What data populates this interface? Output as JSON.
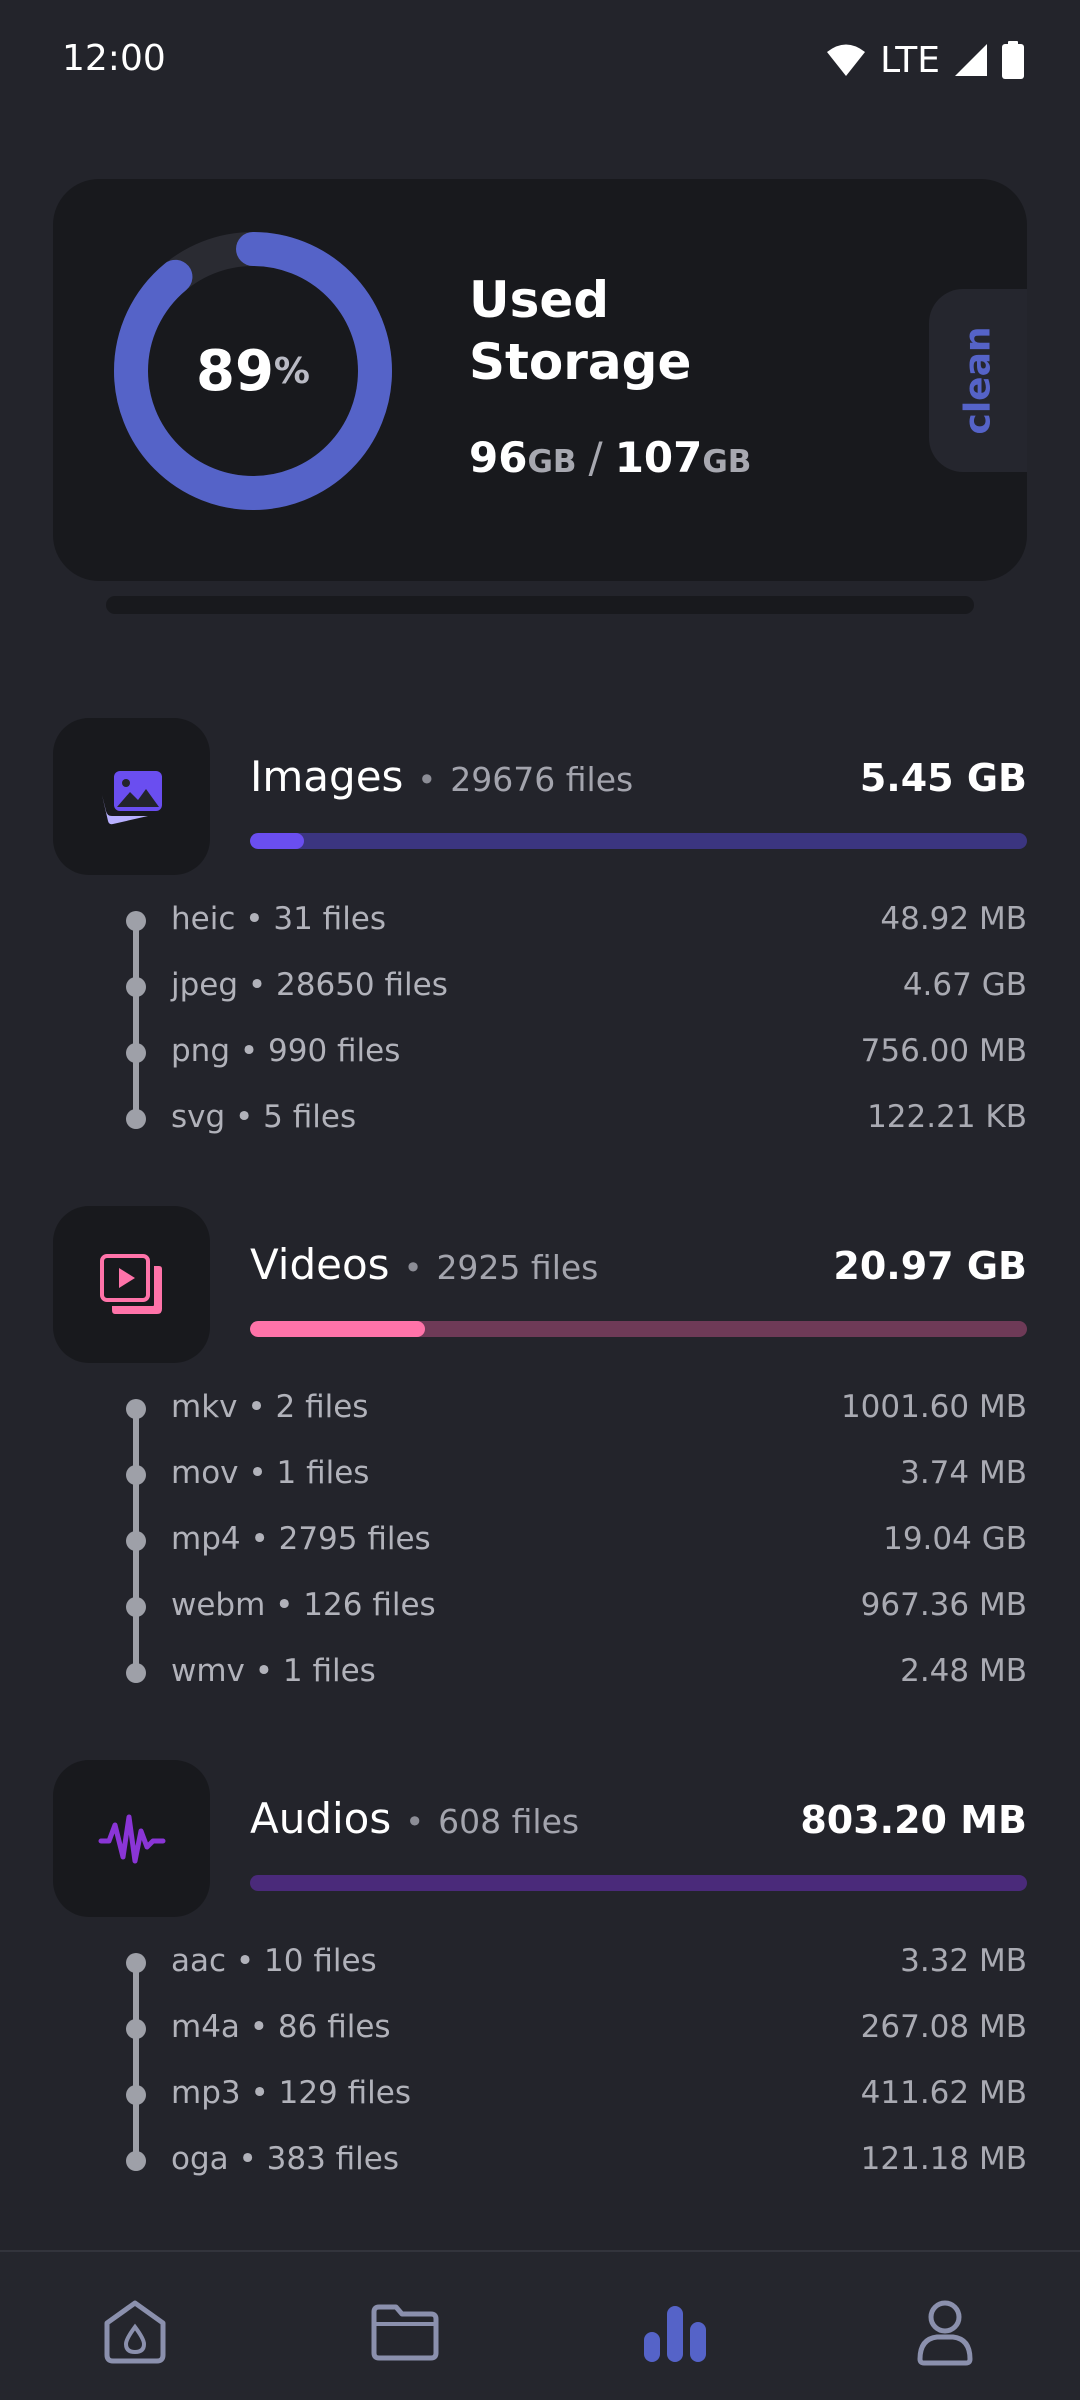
{
  "status_bar": {
    "time": "12:00",
    "network": "LTE"
  },
  "storage": {
    "percent": "89",
    "percent_unit": "%",
    "percent_value": 0.89,
    "title_line1": "Used",
    "title_line2": "Storage",
    "used": "96",
    "used_unit": "GB",
    "separator": "/",
    "total": "107",
    "total_unit": "GB",
    "clean_label": "clean",
    "ring_color": "#5563c8"
  },
  "categories": [
    {
      "name": "Images",
      "count": "29676 files",
      "size": "5.45 GB",
      "icon": "images-icon",
      "bar_fill": 0.07,
      "bar_color": "#6a4ef0",
      "bar_track": "#3b3580",
      "items": [
        {
          "label": "heic • 31 files",
          "size": "48.92 MB"
        },
        {
          "label": "jpeg • 28650 files",
          "size": "4.67 GB"
        },
        {
          "label": "png • 990 files",
          "size": "756.00 MB"
        },
        {
          "label": "svg • 5 files",
          "size": "122.21 KB"
        }
      ]
    },
    {
      "name": "Videos",
      "count": "2925 files",
      "size": "20.97 GB",
      "icon": "videos-icon",
      "bar_fill": 0.225,
      "bar_color": "#ff73a9",
      "bar_track": "#6e3a57",
      "items": [
        {
          "label": "mkv • 2 files",
          "size": "1001.60 MB"
        },
        {
          "label": "mov • 1 files",
          "size": "3.74 MB"
        },
        {
          "label": "mp4 • 2795 files",
          "size": "19.04 GB"
        },
        {
          "label": "webm • 126 files",
          "size": "967.36 MB"
        },
        {
          "label": "wmv • 1 files",
          "size": "2.48 MB"
        }
      ]
    },
    {
      "name": "Audios",
      "count": "608 files",
      "size": "803.20 MB",
      "icon": "audio-wave-icon",
      "bar_fill": 0.0,
      "bar_color": "#8a35d6",
      "bar_track": "#4a2a7a",
      "items": [
        {
          "label": "aac • 10 files",
          "size": "3.32 MB"
        },
        {
          "label": "m4a • 86 files",
          "size": "267.08 MB"
        },
        {
          "label": "mp3 • 129 files",
          "size": "411.62 MB"
        },
        {
          "label": "oga • 383 files",
          "size": "121.18 MB"
        }
      ]
    }
  ],
  "bottom_nav": [
    {
      "name": "home",
      "icon": "home-drop-icon",
      "active": false
    },
    {
      "name": "files",
      "icon": "folder-icon",
      "active": false
    },
    {
      "name": "stats",
      "icon": "bar-chart-icon",
      "active": true
    },
    {
      "name": "profile",
      "icon": "user-icon",
      "active": false
    }
  ]
}
